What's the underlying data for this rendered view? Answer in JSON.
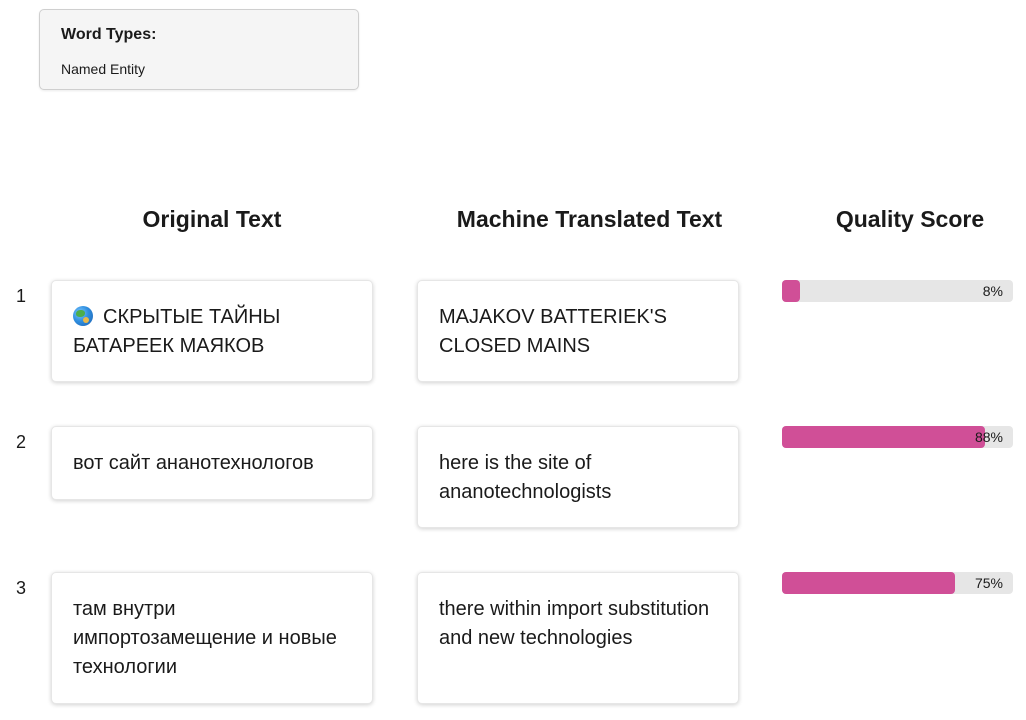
{
  "word_types": {
    "title": "Word Types:",
    "value": "Named Entity"
  },
  "headers": {
    "original": "Original Text",
    "machine": "Machine Translated Text",
    "quality": "Quality Score"
  },
  "rows": [
    {
      "number": "1",
      "icon": "globe-icon",
      "original": "СКРЫТЫЕ ТАЙНЫ БАТАРЕЕК МАЯКОВ",
      "translated": "MAJAKOV BATTERIEK'S CLOSED MAINS",
      "score": 8,
      "score_label": "8%"
    },
    {
      "number": "2",
      "original": "вот сайт ананотехнологов",
      "translated": "here is the site of ananotechnologists",
      "score": 88,
      "score_label": "88%"
    },
    {
      "number": "3",
      "original": "там внутри импортозамещение и новые технологии",
      "translated": "there within import substitution and new technologies",
      "score": 75,
      "score_label": "75%"
    }
  ],
  "colors": {
    "score_fill": "#d04f97",
    "score_track": "#e6e6e6"
  }
}
